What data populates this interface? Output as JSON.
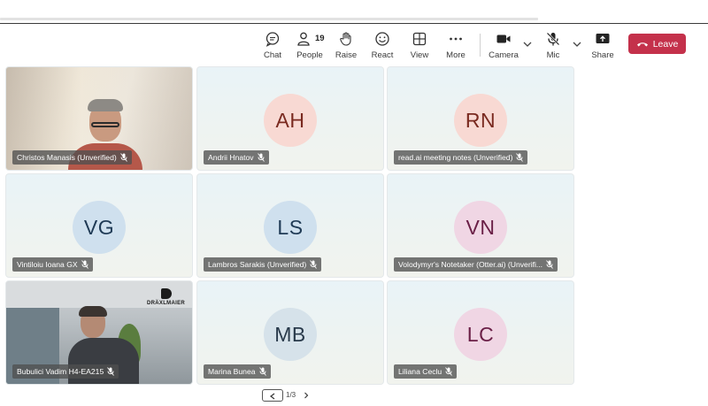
{
  "toolbar": {
    "chat": "Chat",
    "people": "People",
    "people_count": "19",
    "raise": "Raise",
    "react": "React",
    "view": "View",
    "more": "More",
    "camera": "Camera",
    "mic": "Mic",
    "share": "Share",
    "leave": "Leave",
    "leave_color": "#c4314b"
  },
  "participants": [
    {
      "name": "Christos Manasis (Unverified)",
      "initials": "",
      "video": true
    },
    {
      "name": "Andrii Hnatov",
      "initials": "AH",
      "avatar_bg": "#f8d9d3",
      "avatar_fg": "#7a2a20"
    },
    {
      "name": "read.ai meeting notes (Unverified)",
      "initials": "RN",
      "avatar_bg": "#f8d9d3",
      "avatar_fg": "#7a2a20"
    },
    {
      "name": "Vintiloiu Ioana GX",
      "initials": "VG",
      "avatar_bg": "#cfe0ee",
      "avatar_fg": "#1f3a55"
    },
    {
      "name": "Lambros Sarakis (Unverified)",
      "initials": "LS",
      "avatar_bg": "#cfe0ee",
      "avatar_fg": "#1f3a55"
    },
    {
      "name": "Volodymyr's Notetaker (Otter.ai) (Unverifi...",
      "initials": "VN",
      "avatar_bg": "#f0d6e4",
      "avatar_fg": "#6a1f46"
    },
    {
      "name": "Bubulici Vadim H4-EA215",
      "initials": "",
      "video": true,
      "logo_text": "DRÄXLMAIER"
    },
    {
      "name": "Marina Bunea",
      "initials": "MB",
      "avatar_bg": "#d6e2ea",
      "avatar_fg": "#28394a"
    },
    {
      "name": "Liliana Ceclu",
      "initials": "LC",
      "avatar_bg": "#f0d6e4",
      "avatar_fg": "#6a1f46"
    }
  ],
  "pager": {
    "text": "1/3"
  }
}
